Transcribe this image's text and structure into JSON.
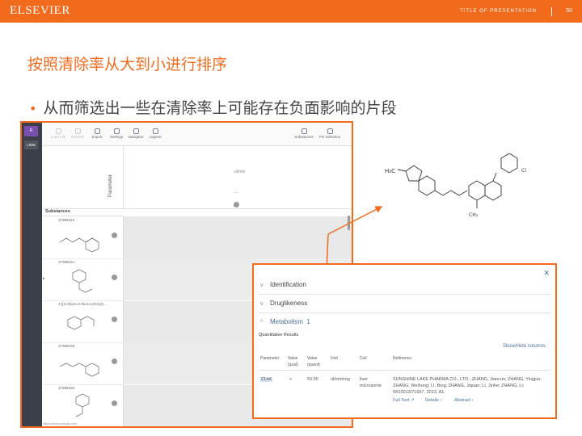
{
  "header": {
    "brand": "ELSEVIER",
    "presentation_title": "TITLE OF PRESENTATION",
    "page_number": "50",
    "accent_color": "#f26b1d"
  },
  "slide": {
    "heading": "按照清除率从大到小进行排序",
    "bullet": "从而筛选出一些在清除率上可能存在负面影响的片段"
  },
  "app": {
    "nav": [
      "R",
      "LIMS"
    ],
    "toolbar": [
      {
        "label": "Load File",
        "icon": "load-icon"
      },
      {
        "label": "Refresh",
        "icon": "refresh-icon"
      },
      {
        "label": "Export",
        "icon": "export-icon"
      },
      {
        "label": "Settings",
        "icon": "settings-icon"
      },
      {
        "label": "Navigator",
        "icon": "navigator-icon"
      },
      {
        "label": "Legend",
        "icon": "legend-icon"
      }
    ],
    "toolbar_right": [
      {
        "label": "Substances",
        "icon": "substances-icon"
      },
      {
        "label": "Pin Selection",
        "icon": "pin-icon"
      }
    ],
    "parameter_label": "Parameter",
    "column_unit": "ul/min",
    "column_dots": "...",
    "substances_header": "Substances",
    "substances": [
      {
        "id": "27385163"
      },
      {
        "id": "27385164"
      },
      {
        "id": "4-[(3-chloro-4-fluoro-phenyl)..."
      },
      {
        "id": "27385158"
      },
      {
        "id": "27385159"
      }
    ],
    "url": "https://www.reaxys.com"
  },
  "panel": {
    "sections": [
      {
        "label": "Identification",
        "chevron": "v"
      },
      {
        "label": "Druglikeness",
        "chevron": "v"
      },
      {
        "label": "Metabolism",
        "chevron": "^",
        "count": "1"
      }
    ],
    "quant_title": "Quantitative Results",
    "show_hide": "Show/Hide columns",
    "columns": [
      "Parameter",
      "Value (qual)",
      "Value (quant)",
      "Unit",
      "Cell",
      "Reference"
    ],
    "row": {
      "parameter": "CLint",
      "qual": "<",
      "quant": "53.95",
      "unit": "ul/min/mg",
      "cell": "liver microsome",
      "reference": "SUNSHINE LAKE PHARMA CO., LTD.; ZHANG, Jiancun; ZHANG, Yingjun; ZHANG, Weihong; LI, Bing; ZHANG, Jiquan; LI, Jinhe; ZHANG, Li; WO2013/71697, 2013, A1"
    },
    "links": [
      "Full Text ↗",
      "Details ›",
      "Abstract ›"
    ]
  }
}
